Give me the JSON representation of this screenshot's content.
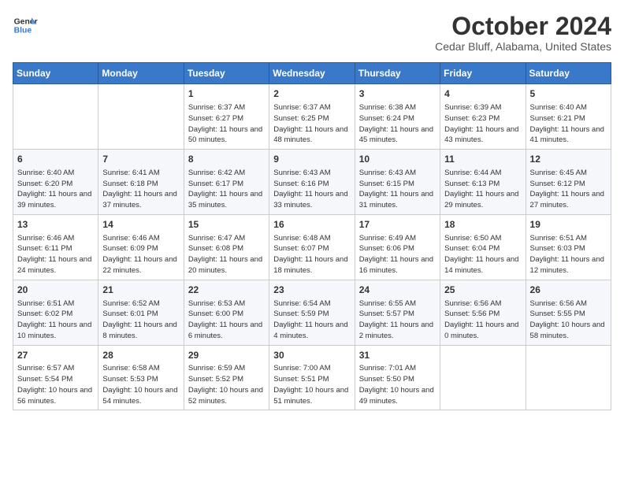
{
  "header": {
    "logo_line1": "General",
    "logo_line2": "Blue",
    "month": "October 2024",
    "location": "Cedar Bluff, Alabama, United States"
  },
  "weekdays": [
    "Sunday",
    "Monday",
    "Tuesday",
    "Wednesday",
    "Thursday",
    "Friday",
    "Saturday"
  ],
  "weeks": [
    [
      {
        "day": "",
        "info": ""
      },
      {
        "day": "",
        "info": ""
      },
      {
        "day": "1",
        "info": "Sunrise: 6:37 AM\nSunset: 6:27 PM\nDaylight: 11 hours and 50 minutes."
      },
      {
        "day": "2",
        "info": "Sunrise: 6:37 AM\nSunset: 6:25 PM\nDaylight: 11 hours and 48 minutes."
      },
      {
        "day": "3",
        "info": "Sunrise: 6:38 AM\nSunset: 6:24 PM\nDaylight: 11 hours and 45 minutes."
      },
      {
        "day": "4",
        "info": "Sunrise: 6:39 AM\nSunset: 6:23 PM\nDaylight: 11 hours and 43 minutes."
      },
      {
        "day": "5",
        "info": "Sunrise: 6:40 AM\nSunset: 6:21 PM\nDaylight: 11 hours and 41 minutes."
      }
    ],
    [
      {
        "day": "6",
        "info": "Sunrise: 6:40 AM\nSunset: 6:20 PM\nDaylight: 11 hours and 39 minutes."
      },
      {
        "day": "7",
        "info": "Sunrise: 6:41 AM\nSunset: 6:18 PM\nDaylight: 11 hours and 37 minutes."
      },
      {
        "day": "8",
        "info": "Sunrise: 6:42 AM\nSunset: 6:17 PM\nDaylight: 11 hours and 35 minutes."
      },
      {
        "day": "9",
        "info": "Sunrise: 6:43 AM\nSunset: 6:16 PM\nDaylight: 11 hours and 33 minutes."
      },
      {
        "day": "10",
        "info": "Sunrise: 6:43 AM\nSunset: 6:15 PM\nDaylight: 11 hours and 31 minutes."
      },
      {
        "day": "11",
        "info": "Sunrise: 6:44 AM\nSunset: 6:13 PM\nDaylight: 11 hours and 29 minutes."
      },
      {
        "day": "12",
        "info": "Sunrise: 6:45 AM\nSunset: 6:12 PM\nDaylight: 11 hours and 27 minutes."
      }
    ],
    [
      {
        "day": "13",
        "info": "Sunrise: 6:46 AM\nSunset: 6:11 PM\nDaylight: 11 hours and 24 minutes."
      },
      {
        "day": "14",
        "info": "Sunrise: 6:46 AM\nSunset: 6:09 PM\nDaylight: 11 hours and 22 minutes."
      },
      {
        "day": "15",
        "info": "Sunrise: 6:47 AM\nSunset: 6:08 PM\nDaylight: 11 hours and 20 minutes."
      },
      {
        "day": "16",
        "info": "Sunrise: 6:48 AM\nSunset: 6:07 PM\nDaylight: 11 hours and 18 minutes."
      },
      {
        "day": "17",
        "info": "Sunrise: 6:49 AM\nSunset: 6:06 PM\nDaylight: 11 hours and 16 minutes."
      },
      {
        "day": "18",
        "info": "Sunrise: 6:50 AM\nSunset: 6:04 PM\nDaylight: 11 hours and 14 minutes."
      },
      {
        "day": "19",
        "info": "Sunrise: 6:51 AM\nSunset: 6:03 PM\nDaylight: 11 hours and 12 minutes."
      }
    ],
    [
      {
        "day": "20",
        "info": "Sunrise: 6:51 AM\nSunset: 6:02 PM\nDaylight: 11 hours and 10 minutes."
      },
      {
        "day": "21",
        "info": "Sunrise: 6:52 AM\nSunset: 6:01 PM\nDaylight: 11 hours and 8 minutes."
      },
      {
        "day": "22",
        "info": "Sunrise: 6:53 AM\nSunset: 6:00 PM\nDaylight: 11 hours and 6 minutes."
      },
      {
        "day": "23",
        "info": "Sunrise: 6:54 AM\nSunset: 5:59 PM\nDaylight: 11 hours and 4 minutes."
      },
      {
        "day": "24",
        "info": "Sunrise: 6:55 AM\nSunset: 5:57 PM\nDaylight: 11 hours and 2 minutes."
      },
      {
        "day": "25",
        "info": "Sunrise: 6:56 AM\nSunset: 5:56 PM\nDaylight: 11 hours and 0 minutes."
      },
      {
        "day": "26",
        "info": "Sunrise: 6:56 AM\nSunset: 5:55 PM\nDaylight: 10 hours and 58 minutes."
      }
    ],
    [
      {
        "day": "27",
        "info": "Sunrise: 6:57 AM\nSunset: 5:54 PM\nDaylight: 10 hours and 56 minutes."
      },
      {
        "day": "28",
        "info": "Sunrise: 6:58 AM\nSunset: 5:53 PM\nDaylight: 10 hours and 54 minutes."
      },
      {
        "day": "29",
        "info": "Sunrise: 6:59 AM\nSunset: 5:52 PM\nDaylight: 10 hours and 52 minutes."
      },
      {
        "day": "30",
        "info": "Sunrise: 7:00 AM\nSunset: 5:51 PM\nDaylight: 10 hours and 51 minutes."
      },
      {
        "day": "31",
        "info": "Sunrise: 7:01 AM\nSunset: 5:50 PM\nDaylight: 10 hours and 49 minutes."
      },
      {
        "day": "",
        "info": ""
      },
      {
        "day": "",
        "info": ""
      }
    ]
  ]
}
